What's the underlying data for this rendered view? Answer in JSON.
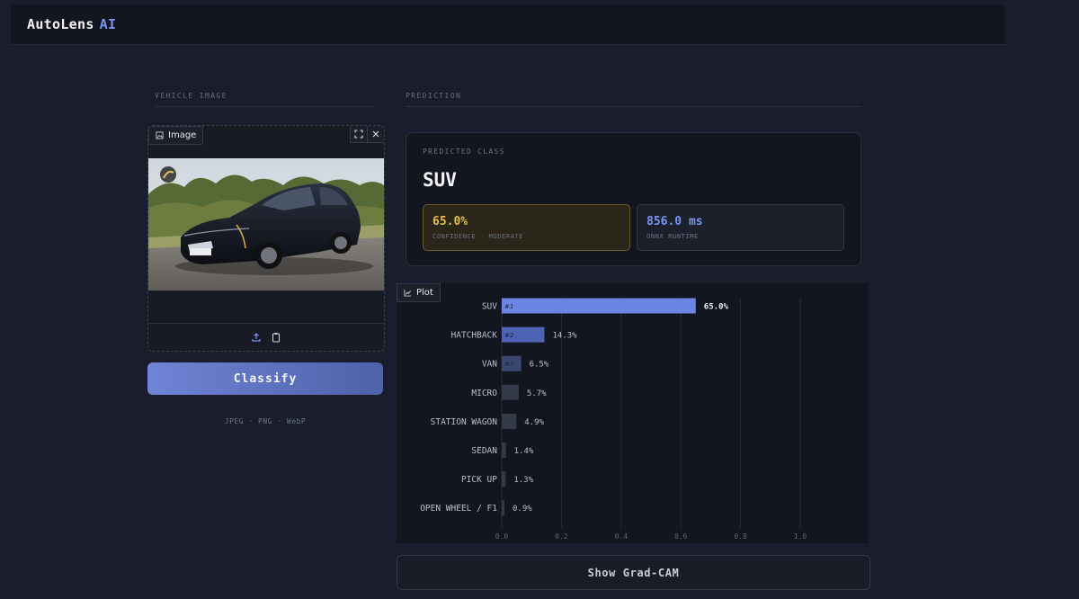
{
  "header": {
    "brand": "AutoLens",
    "brand_accent": "AI"
  },
  "left": {
    "section_label": "VEHICLE IMAGE",
    "image_tag": "Image",
    "classify_label": "Classify",
    "formats": "JPEG · PNG · WebP"
  },
  "right": {
    "section_label": "PREDICTION",
    "predicted_label": "PREDICTED CLASS",
    "predicted_class": "SUV",
    "confidence_value": "65.0%",
    "confidence_label": "CONFIDENCE · MODERATE",
    "runtime_value": "856.0 ms",
    "runtime_label": "ONNX RUNTIME",
    "plot_tag": "Plot",
    "gradcam_label": "Show Grad-CAM"
  },
  "colors": {
    "accent": "#7b93f2",
    "confidence": "#e5bd4f",
    "background": "#1a1e2c"
  },
  "chart_data": {
    "type": "bar",
    "orientation": "horizontal",
    "categories": [
      "SUV",
      "HATCHBACK",
      "VAN",
      "MICRO",
      "STATION WAGON",
      "SEDAN",
      "PICK UP",
      "OPEN WHEEL / F1"
    ],
    "values": [
      0.65,
      0.143,
      0.065,
      0.057,
      0.049,
      0.014,
      0.013,
      0.009
    ],
    "value_labels": [
      "65.0%",
      "14.3%",
      "6.5%",
      "5.7%",
      "4.9%",
      "1.4%",
      "1.3%",
      "0.9%"
    ],
    "rank_labels": [
      "#1",
      "#2",
      "#3"
    ],
    "xlim": [
      0,
      1
    ],
    "xticks": [
      "0.0",
      "0.2",
      "0.4",
      "0.6",
      "0.8",
      "1.0"
    ],
    "grid": true,
    "bar_colors": [
      "#6c84e4",
      "#4d63b4",
      "#3a4870",
      "#343a48",
      "#343a48",
      "#343a48",
      "#343a48",
      "#343a48"
    ]
  }
}
